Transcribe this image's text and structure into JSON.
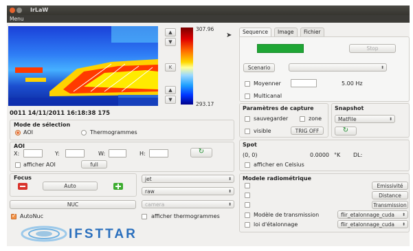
{
  "window": {
    "title": "IrLaW",
    "menu": "Menu"
  },
  "viewer": {
    "timestamp": "0011 14/11/2011 16:18:38 175",
    "colorbar_max": "307.96",
    "colorbar_min": "293.17",
    "k_button": "K"
  },
  "selection_mode": {
    "title": "Mode de sélection",
    "options": [
      {
        "label": "AOI",
        "selected": true
      },
      {
        "label": "Thermogrammes",
        "selected": false
      }
    ]
  },
  "aoi": {
    "title": "AOI",
    "x_label": "X:",
    "y_label": "Y:",
    "w_label": "W:",
    "h_label": "H:",
    "x_value": "",
    "y_value": "",
    "w_value": "",
    "h_value": "",
    "show_label": "afficher AOI",
    "full_button": "full"
  },
  "focus": {
    "title": "Focus",
    "auto_button": "Auto",
    "nuc_button": "NUC",
    "autonuc_label": "AutoNuc",
    "autonuc_checked": true
  },
  "display": {
    "colormap": "jet",
    "format": "raw",
    "source": "camera",
    "show_thermograms_label": "afficher thermogrammes"
  },
  "logo": {
    "text": "IFSTTAR"
  },
  "tabs": [
    {
      "label": "Sequence",
      "active": true
    },
    {
      "label": "Image",
      "active": false
    },
    {
      "label": "Fichier",
      "active": false
    }
  ],
  "sequence": {
    "start_label": "",
    "stop_label": "Stop",
    "scenario_button": "Scenario",
    "scenario_value": "",
    "moyenner_label": "Moyenner",
    "moyenner_value": "",
    "frequency": "5.00 Hz",
    "multicanal_label": "Multicanal"
  },
  "capture": {
    "title": "Paramètres de capture",
    "save_label": "sauvegarder",
    "zone_label": "zone",
    "visible_label": "visible",
    "trig_button": "TRIG OFF"
  },
  "snapshot": {
    "title": "Snapshot",
    "format": "MatFile"
  },
  "spot": {
    "title": "Spot",
    "coords": "(0, 0)",
    "value": "0.0000",
    "unit": "°K",
    "dl_label": "DL:",
    "celsius_label": "afficher en Celsius"
  },
  "radiometric": {
    "title": "Modele radiométrique",
    "buttons": [
      "Emissivité",
      "Distance",
      "Transmission"
    ],
    "transmission_model_label": "Modèle de transmission",
    "transmission_model_value": "flir_etalonnage_cuda",
    "calibration_law_label": "loi d'étalonnage",
    "calibration_law_value": "flir_etalonnage_cuda"
  },
  "colors": {
    "accent": "#f29245",
    "start_green": "#1fa635",
    "logo_blue": "#2a6fbd"
  }
}
